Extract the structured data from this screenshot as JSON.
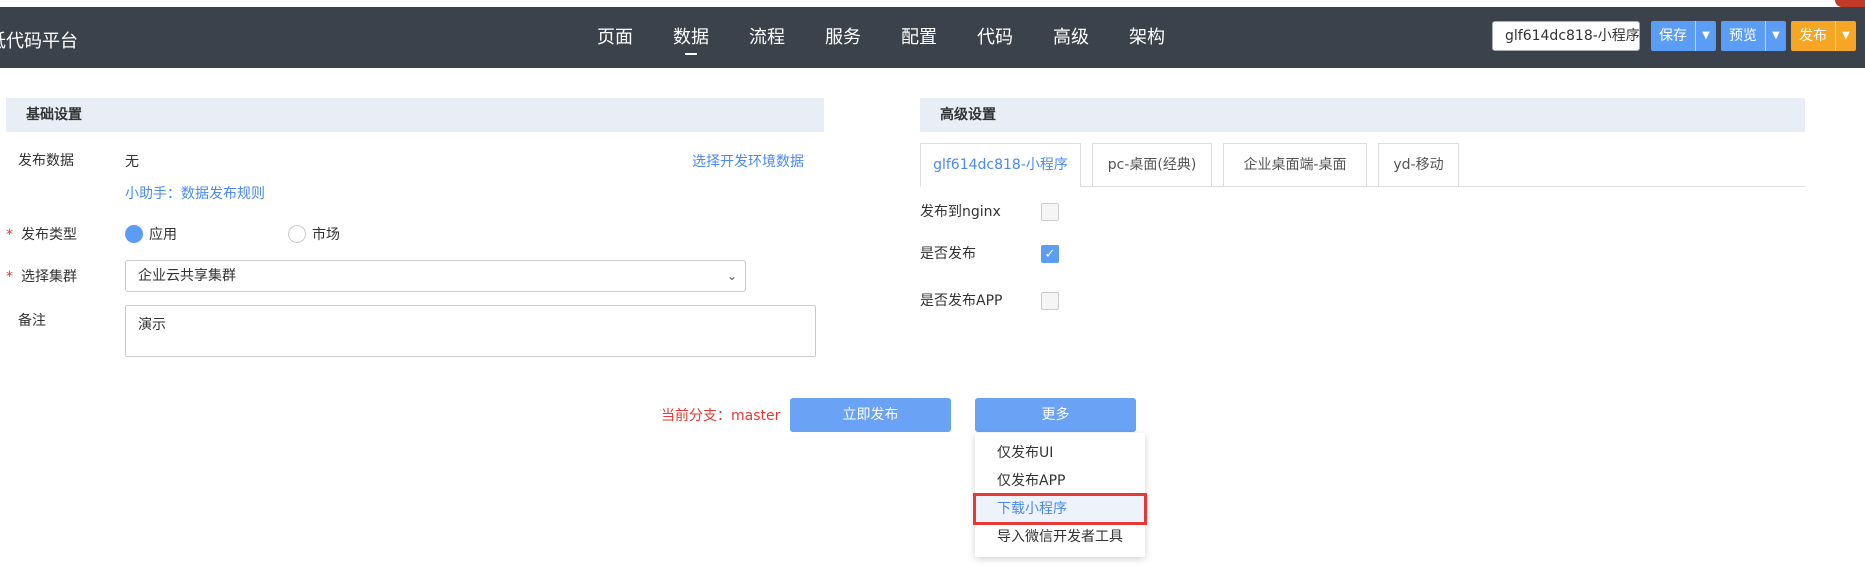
{
  "header": {
    "brand": "低代码平台",
    "nav": [
      "页面",
      "数据",
      "流程",
      "服务",
      "配置",
      "代码",
      "高级",
      "架构"
    ],
    "active_nav": "数据",
    "app_select": "glf614dc818-小程序",
    "save_label": "保存",
    "preview_label": "预览",
    "publish_label": "发布"
  },
  "basic": {
    "title": "基础设置",
    "publish_data_label": "发布数据",
    "publish_data_value": "无",
    "choose_env_link": "选择开发环境数据",
    "helper_link": "小助手：数据发布规则",
    "publish_type_label": "发布类型",
    "publish_type_options": [
      "应用",
      "市场"
    ],
    "cluster_label": "选择集群",
    "cluster_value": "企业云共享集群",
    "remark_label": "备注",
    "remark_value": "演示"
  },
  "advanced": {
    "title": "高级设置",
    "tabs": [
      "glf614dc818-小程序",
      "pc-桌面(经典)",
      "企业桌面端-桌面",
      "yd-移动"
    ],
    "nginx_label": "发布到nginx",
    "nginx_checked": false,
    "publish_label": "是否发布",
    "publish_checked": true,
    "app_label": "是否发布APP",
    "app_checked": false
  },
  "actions": {
    "branch_text": "当前分支：master",
    "publish_now": "立即发布",
    "more": "更多",
    "more_menu": [
      "仅发布UI",
      "仅发布APP",
      "下载小程序",
      "导入微信开发者工具"
    ],
    "highlighted_item": "下载小程序"
  },
  "colors": {
    "navbar": "#3c424c",
    "accent_blue": "#5b9df5",
    "accent_orange": "#f5a623",
    "required_red": "#e53935",
    "link_blue": "#4a8af4"
  }
}
